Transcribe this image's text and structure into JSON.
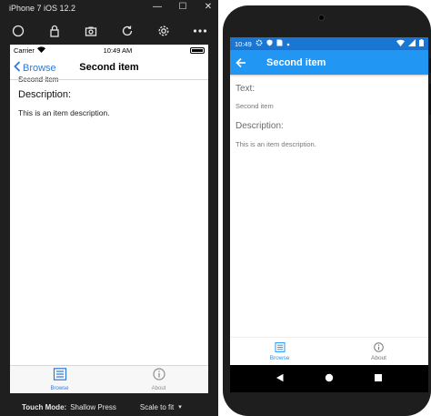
{
  "simulator": {
    "title": "iPhone 7 iOS 12.2",
    "footer": {
      "touch_mode_label": "Touch Mode:",
      "touch_mode_value": "Shallow Press",
      "scale_label": "Scale to fit"
    }
  },
  "ios": {
    "status": {
      "carrier": "Carrier",
      "time": "10:49 AM"
    },
    "nav": {
      "back_label": "Browse",
      "title": "Second item"
    },
    "content": {
      "text_value_cut": "Second item",
      "description_label": "Description:",
      "description_value": "This is an item description."
    },
    "tabs": [
      {
        "label": "Browse",
        "icon": "list-icon",
        "active": true
      },
      {
        "label": "About",
        "icon": "info-icon",
        "active": false
      }
    ]
  },
  "android": {
    "status": {
      "time": "10:49"
    },
    "appbar": {
      "title": "Second item"
    },
    "content": {
      "text_label": "Text:",
      "text_value": "Second item",
      "description_label": "Description:",
      "description_value": "This is an item description."
    },
    "tabs": [
      {
        "label": "Browse",
        "icon": "list-icon",
        "active": true
      },
      {
        "label": "About",
        "icon": "info-icon",
        "active": false
      }
    ]
  },
  "colors": {
    "ios_accent": "#2f7ad6",
    "android_primary": "#2196f3",
    "android_status": "#1976d2",
    "simulator_chrome": "#1f1f1f"
  }
}
